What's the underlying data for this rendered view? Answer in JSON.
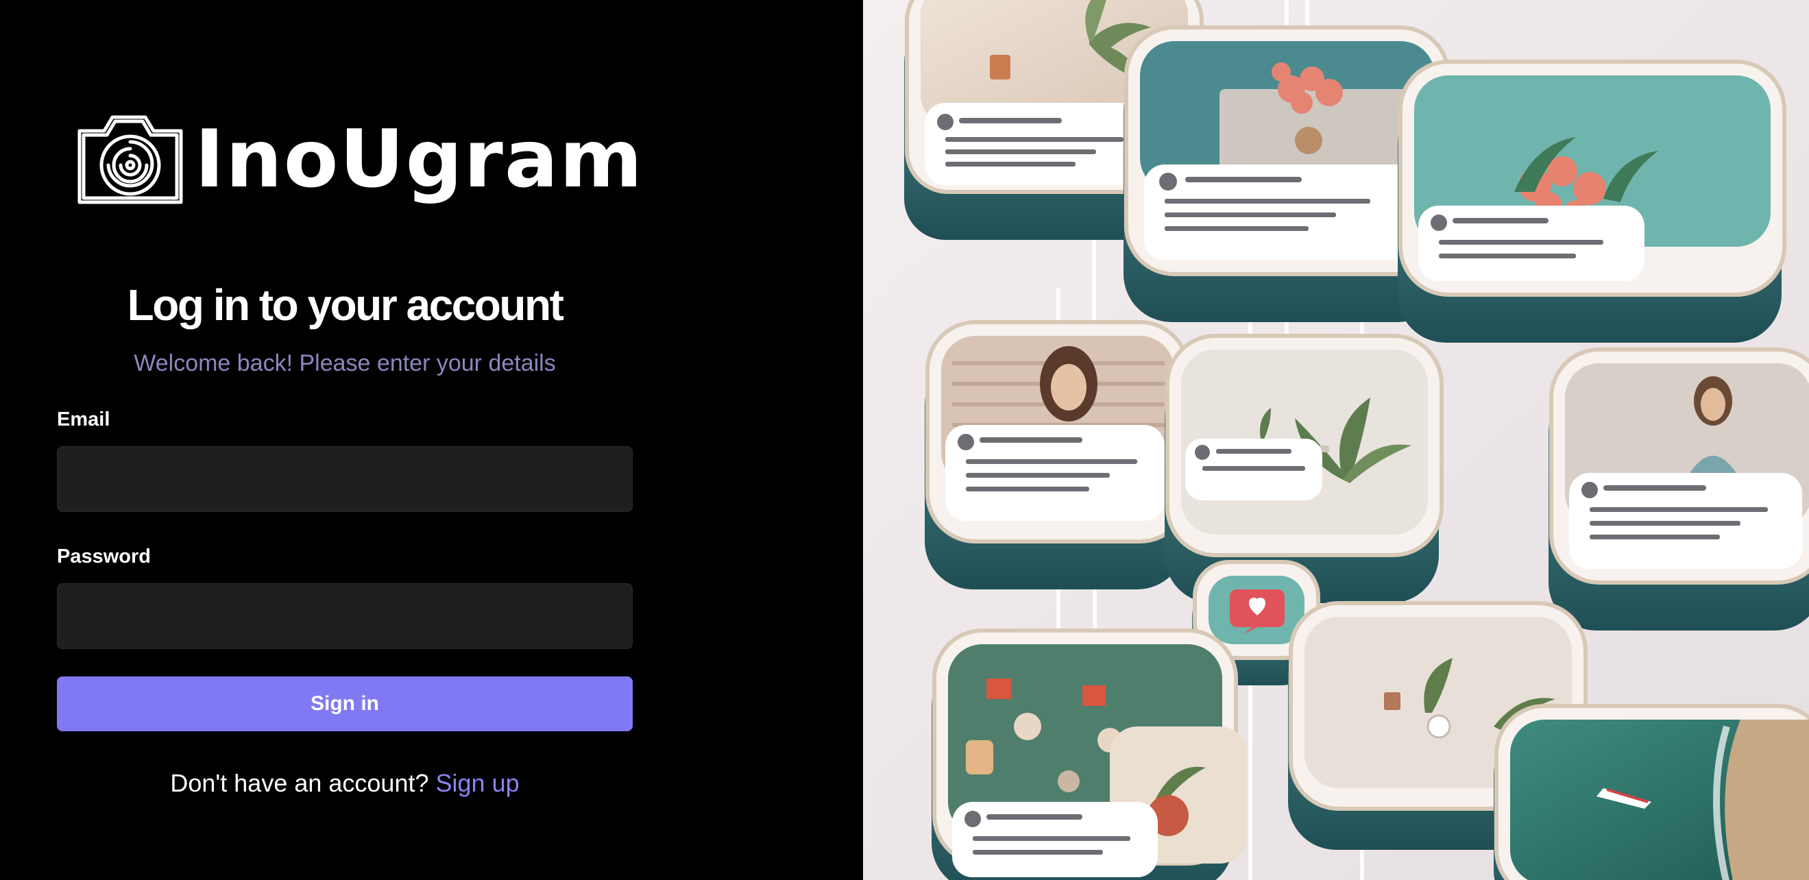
{
  "brand": {
    "name": "InoUgram",
    "logo_icon": "camera-spiral-logo-icon"
  },
  "login": {
    "title": "Log in to your account",
    "subtitle": "Welcome back! Please enter your details",
    "email_label": "Email",
    "email_value": "",
    "password_label": "Password",
    "password_value": "",
    "submit_label": "Sign in",
    "signup_prompt": "Don't have an account?",
    "signup_link": "Sign up"
  },
  "colors": {
    "background": "#000000",
    "accent": "#8179f4",
    "subtitle": "#8b87c0",
    "input_bg": "#1f1f21"
  },
  "hero": {
    "icon": "social-feed-collage-illustration"
  }
}
